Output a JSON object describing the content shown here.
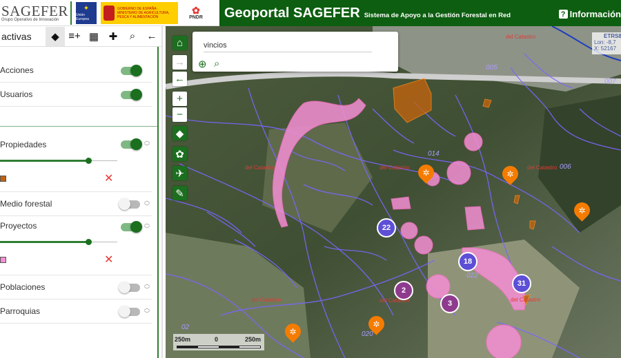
{
  "header": {
    "brand_name": "SAGEFER",
    "brand_sub": "Grupo Operativo de Innovación",
    "logo_eu_text": "Unión Europea",
    "logo_gob_text": "GOBIERNO DE ESPAÑA · MINISTERIO DE AGRICULTURA, PESCA Y ALIMENTACIÓN",
    "logo_pndr": "PNDR",
    "title": "Geoportal SAGEFER",
    "subtitle": "Sistema de Apoyo a la Gestión Forestal en Red",
    "info_label": "Información",
    "info_icon": "?"
  },
  "panel": {
    "title": "activas",
    "tools": [
      {
        "name": "layers-tab-icon",
        "glyph": "◆"
      },
      {
        "name": "add-list-icon",
        "glyph": "≡+"
      },
      {
        "name": "grid-icon",
        "glyph": "▦"
      },
      {
        "name": "add-layer-icon",
        "glyph": "✚"
      },
      {
        "name": "search-icon",
        "glyph": "⌕"
      },
      {
        "name": "back-arrow-icon",
        "glyph": "←"
      }
    ],
    "layers": [
      {
        "label": "Acciones",
        "on": true
      },
      {
        "label": "Usuarios",
        "on": true
      },
      {
        "label": "Propiedades",
        "on": true,
        "opacity": 0.75,
        "color": "#c0630f"
      },
      {
        "label": "Medio forestal",
        "on": false
      },
      {
        "label": "Proyectos",
        "on": true,
        "opacity": 0.75,
        "color": "#f48fd4"
      },
      {
        "label": "Poblaciones",
        "on": false
      },
      {
        "label": "Parroquias",
        "on": false
      }
    ],
    "remove_glyph": "✕",
    "arrow_up": "︿",
    "arrow_down": "﹀"
  },
  "map": {
    "tools": [
      {
        "name": "home-icon",
        "glyph": "⌂",
        "style": "green"
      },
      {
        "name": "forward-arrow-icon",
        "glyph": "→",
        "style": "dis"
      },
      {
        "name": "back-arrow-icon",
        "glyph": "←",
        "style": ""
      },
      {
        "name": "zoom-in-icon",
        "glyph": "+",
        "style": ""
      },
      {
        "name": "zoom-out-icon",
        "glyph": "−",
        "style": ""
      },
      {
        "name": "layers-icon",
        "glyph": "◆",
        "style": "green"
      },
      {
        "name": "settings-icon",
        "glyph": "✿",
        "style": "green"
      },
      {
        "name": "compass-icon",
        "glyph": "✈",
        "style": "green"
      },
      {
        "name": "edit-icon",
        "glyph": "✎",
        "style": "green"
      }
    ],
    "search_value": "vincios",
    "search_add_glyph": "⊕",
    "search_find_glyph": "⌕",
    "coords_title": "ETRS8",
    "coords_lon": "Lon: -8,7",
    "coords_x": "X: 52167",
    "scale_labels": [
      "250m",
      "0",
      "250m"
    ],
    "clusters": [
      {
        "count": "22",
        "color": "#5d4fd6"
      },
      {
        "count": "18",
        "color": "#5d4fd6"
      },
      {
        "count": "31",
        "color": "#5d4fd6"
      },
      {
        "count": "2",
        "color": "#8e3b8e"
      },
      {
        "count": "3",
        "color": "#8e3b8e"
      }
    ],
    "pin_glyph": "✲",
    "parcel_labels": [
      "del Catastro",
      "del Catastro",
      "del Catastro",
      "del Catastro",
      "del Catastro",
      "del Catastro",
      "del Catastro"
    ],
    "area_numbers": [
      "005",
      "007",
      "006",
      "014",
      "022",
      "020",
      "02"
    ]
  }
}
